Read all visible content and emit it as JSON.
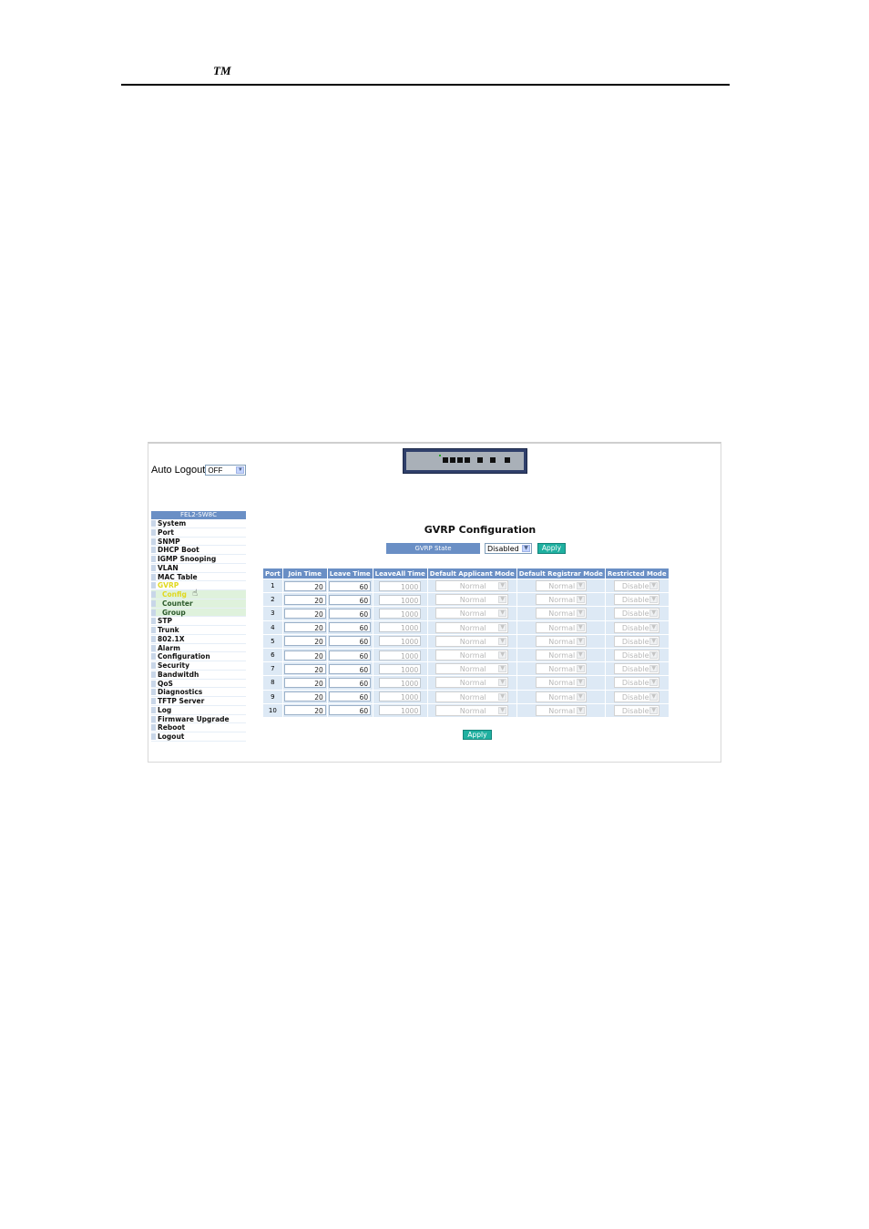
{
  "page": {
    "header_mark": "TM"
  },
  "autologout": {
    "label": "Auto Logout",
    "value": "OFF"
  },
  "menu": {
    "title": "FEL2-SW8C",
    "items": [
      "System",
      "Port",
      "SNMP",
      "DHCP Boot",
      "IGMP Snooping",
      "VLAN",
      "MAC Table",
      "GVRP"
    ],
    "gvrp_sub": [
      "Config",
      "Counter",
      "Group"
    ],
    "items_after": [
      "STP",
      "Trunk",
      "802.1X",
      "Alarm",
      "Configuration",
      "Security",
      "Bandwitdh",
      "QoS",
      "Diagnostics",
      "TFTP Server",
      "Log",
      "Firmware Upgrade",
      "Reboot",
      "Logout"
    ]
  },
  "main": {
    "title": "GVRP Configuration",
    "state_label": "GVRP State",
    "state_value": "Disabled",
    "apply_label": "Apply",
    "columns": [
      "Port",
      "Join Time",
      "Leave Time",
      "LeaveAll Time",
      "Default Applicant Mode",
      "Default Registrar Mode",
      "Restricted Mode"
    ],
    "rows": [
      {
        "port": "1",
        "join": "20",
        "leave": "60",
        "leaveall": "1000",
        "applicant": "Normal",
        "registrar": "Normal",
        "restricted": "Disabled"
      },
      {
        "port": "2",
        "join": "20",
        "leave": "60",
        "leaveall": "1000",
        "applicant": "Normal",
        "registrar": "Normal",
        "restricted": "Disabled"
      },
      {
        "port": "3",
        "join": "20",
        "leave": "60",
        "leaveall": "1000",
        "applicant": "Normal",
        "registrar": "Normal",
        "restricted": "Disabled"
      },
      {
        "port": "4",
        "join": "20",
        "leave": "60",
        "leaveall": "1000",
        "applicant": "Normal",
        "registrar": "Normal",
        "restricted": "Disabled"
      },
      {
        "port": "5",
        "join": "20",
        "leave": "60",
        "leaveall": "1000",
        "applicant": "Normal",
        "registrar": "Normal",
        "restricted": "Disabled"
      },
      {
        "port": "6",
        "join": "20",
        "leave": "60",
        "leaveall": "1000",
        "applicant": "Normal",
        "registrar": "Normal",
        "restricted": "Disabled"
      },
      {
        "port": "7",
        "join": "20",
        "leave": "60",
        "leaveall": "1000",
        "applicant": "Normal",
        "registrar": "Normal",
        "restricted": "Disabled"
      },
      {
        "port": "8",
        "join": "20",
        "leave": "60",
        "leaveall": "1000",
        "applicant": "Normal",
        "registrar": "Normal",
        "restricted": "Disabled"
      },
      {
        "port": "9",
        "join": "20",
        "leave": "60",
        "leaveall": "1000",
        "applicant": "Normal",
        "registrar": "Normal",
        "restricted": "Disabled"
      },
      {
        "port": "10",
        "join": "20",
        "leave": "60",
        "leaveall": "1000",
        "applicant": "Normal",
        "registrar": "Normal",
        "restricted": "Disabled"
      }
    ]
  },
  "colors": {
    "header_blue": "#6a8fc5",
    "button_teal": "#1fb0a0",
    "cell_bg": "#dde9f5"
  }
}
